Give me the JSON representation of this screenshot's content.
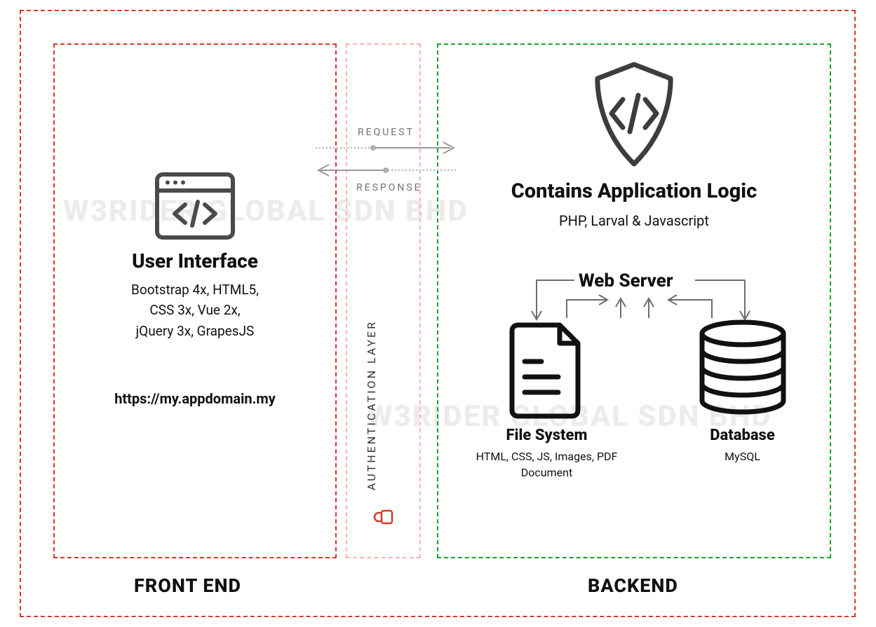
{
  "watermark1": "W3RIDER GLOBAL SDN BHD",
  "watermark2": "W3RIDER GLOBAL SDN BHD",
  "frontend": {
    "label": "FRONT END",
    "title": "User Interface",
    "tech_line1": "Bootstrap 4x, HTML5,",
    "tech_line2": "CSS 3x, Vue 2x,",
    "tech_line3": "jQuery 3x, GrapesJS",
    "url": "https://my.appdomain.my"
  },
  "auth": {
    "label": "AUTHENTICATION LAYER"
  },
  "arrows": {
    "request": "REQUEST",
    "response": "RESPONSE"
  },
  "backend": {
    "label": "BACKEND",
    "logic_title": "Contains Application Logic",
    "logic_sub": "PHP, Larval & Javascript",
    "web_server": "Web Server",
    "filesystem": {
      "title": "File System",
      "sub": "HTML, CSS, JS, Images, PDF Document"
    },
    "database": {
      "title": "Database",
      "sub": "MySQL"
    }
  }
}
